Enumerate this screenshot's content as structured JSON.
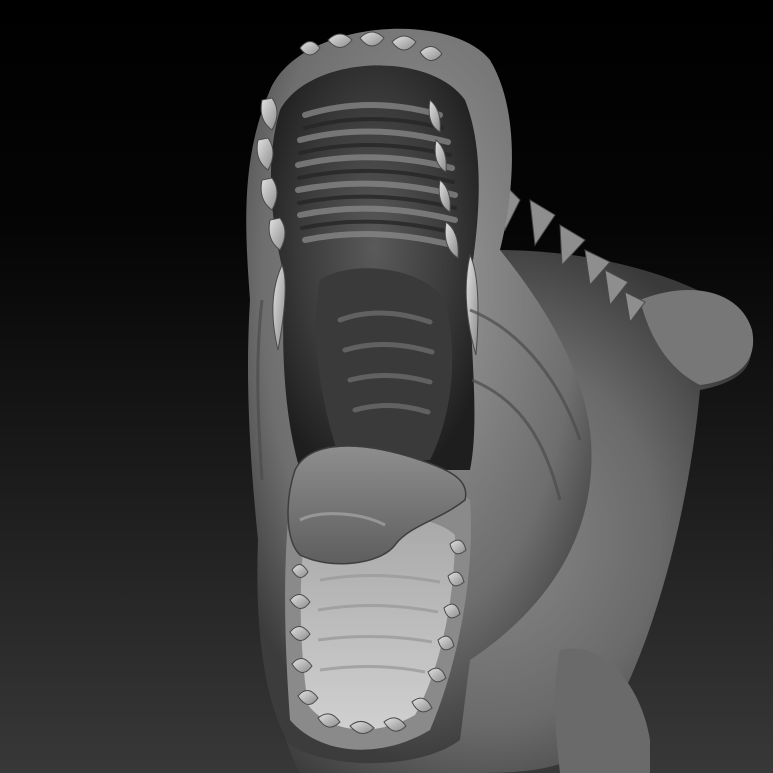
{
  "scene": {
    "subject": "sculpt-render",
    "material": "grey-clay",
    "colors": {
      "background_top": "#000000",
      "background_bottom": "#383838",
      "clay_light": "#bdbdbd",
      "clay_mid": "#7e7e7e",
      "clay_dark": "#2e2e2e"
    }
  }
}
